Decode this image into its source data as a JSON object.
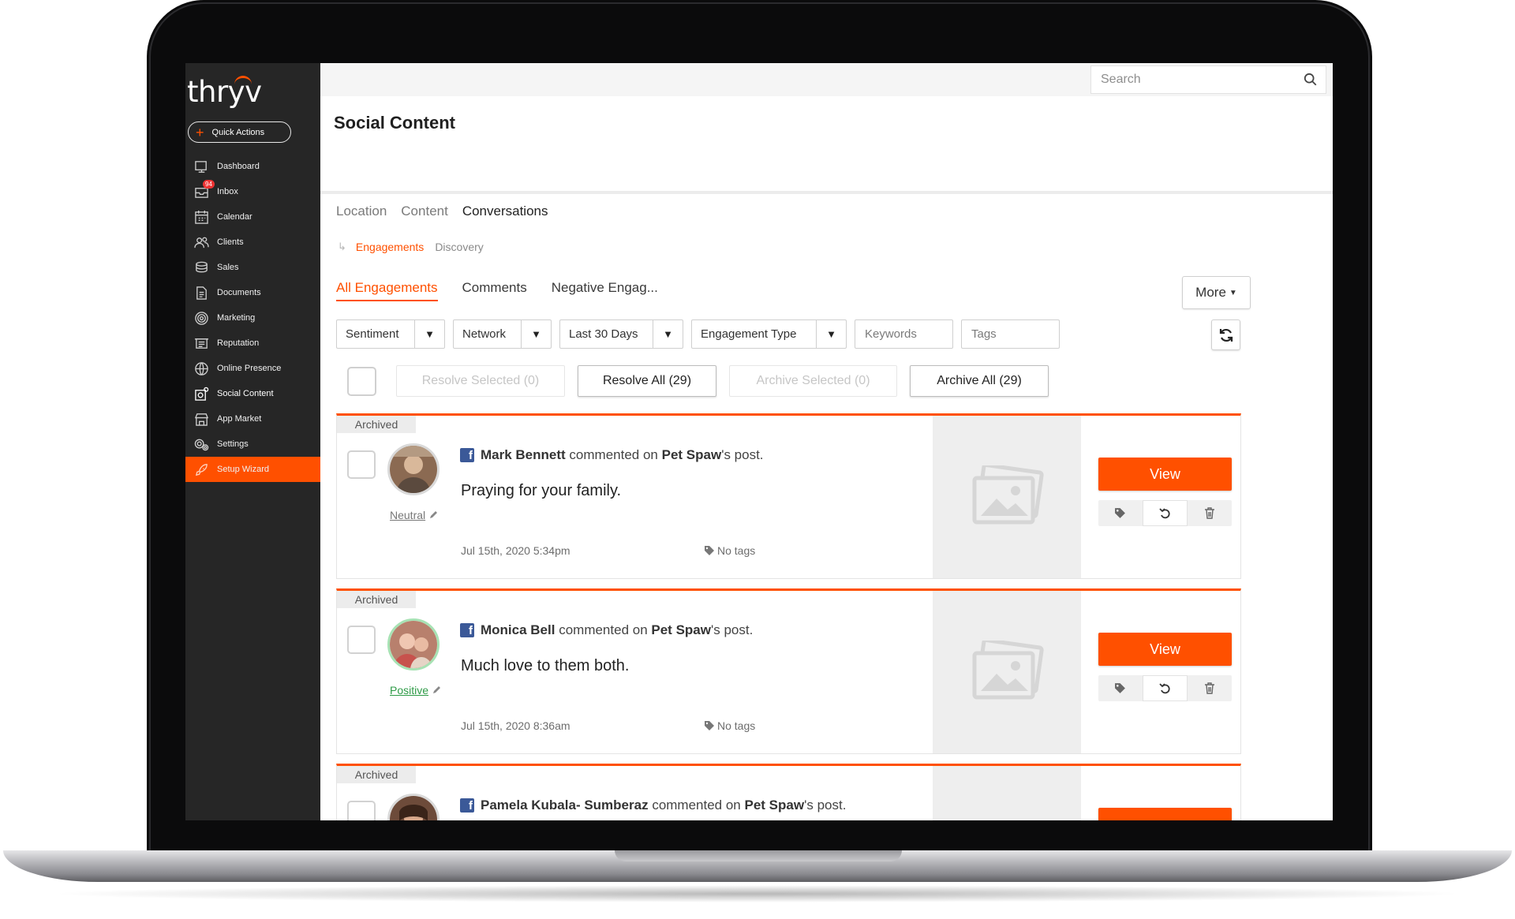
{
  "app": {
    "logo": "thryv",
    "quick_actions": "Quick Actions"
  },
  "sidebar": {
    "items": [
      {
        "label": "Dashboard",
        "icon": "dashboard-icon"
      },
      {
        "label": "Inbox",
        "icon": "inbox-icon",
        "badge": "94"
      },
      {
        "label": "Calendar",
        "icon": "calendar-icon"
      },
      {
        "label": "Clients",
        "icon": "clients-icon"
      },
      {
        "label": "Sales",
        "icon": "sales-icon"
      },
      {
        "label": "Documents",
        "icon": "documents-icon"
      },
      {
        "label": "Marketing",
        "icon": "marketing-icon"
      },
      {
        "label": "Reputation",
        "icon": "reputation-icon"
      },
      {
        "label": "Online Presence",
        "icon": "globe-icon"
      },
      {
        "label": "Social Content",
        "icon": "social-content-icon",
        "active": true
      },
      {
        "label": "App Market",
        "icon": "app-market-icon"
      },
      {
        "label": "Settings",
        "icon": "settings-icon"
      },
      {
        "label": "Setup Wizard",
        "icon": "rocket-icon"
      }
    ]
  },
  "search": {
    "placeholder": "Search"
  },
  "page": {
    "title": "Social Content"
  },
  "tabs_primary": [
    "Location",
    "Content",
    "Conversations"
  ],
  "tabs_secondary": {
    "active": "Engagements",
    "other": "Discovery"
  },
  "tabs_engagement": [
    "All Engagements",
    "Comments",
    "Negative Engag..."
  ],
  "more_label": "More",
  "filters": {
    "sentiment": "Sentiment",
    "network": "Network",
    "date": "Last 30 Days",
    "engagement_type": "Engagement Type",
    "keywords_placeholder": "Keywords",
    "tags_placeholder": "Tags"
  },
  "bulk": {
    "resolve_selected": "Resolve Selected (0)",
    "resolve_all": "Resolve All (29)",
    "archive_selected": "Archive Selected (0)",
    "archive_all": "Archive All (29)"
  },
  "engagements": [
    {
      "status": "Archived",
      "author": "Mark Bennett",
      "verb": "commented on",
      "page": "Pet Spaw",
      "suffix": "'s post.",
      "comment": "Praying for your family.",
      "sentiment": "Neutral",
      "date": "Jul 15th, 2020 5:34pm",
      "tags": "No tags",
      "view": "View"
    },
    {
      "status": "Archived",
      "author": "Monica Bell",
      "verb": "commented on",
      "page": "Pet Spaw",
      "suffix": "'s post.",
      "comment": "Much love to them both.",
      "sentiment": "Positive",
      "date": "Jul 15th, 2020 8:36am",
      "tags": "No tags",
      "view": "View"
    },
    {
      "status": "Archived",
      "author": "Pamela Kubala- Sumberaz",
      "verb": "commented on",
      "page": "Pet Spaw",
      "suffix": "'s post.",
      "comment": "",
      "sentiment": "",
      "date": "",
      "tags": "",
      "view": ""
    }
  ],
  "colors": {
    "accent": "#ff5000",
    "sidebar": "#262626",
    "facebook": "#3b5998",
    "positive": "#2e9b47"
  }
}
